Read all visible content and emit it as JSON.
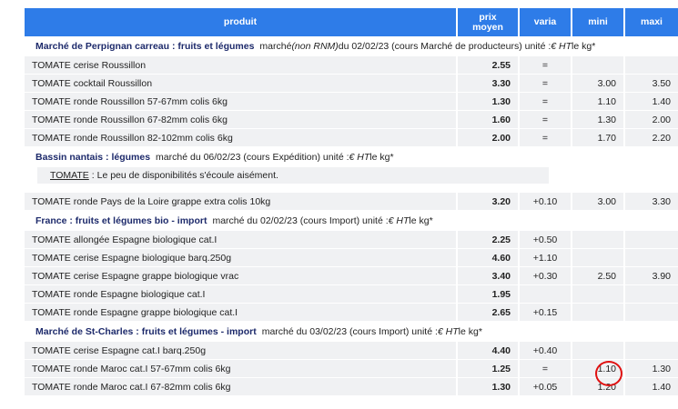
{
  "header": {
    "produit": "produit",
    "prix": "prix",
    "moyen": "moyen",
    "varia": "varia",
    "mini": "mini",
    "maxi": "maxi"
  },
  "sections": [
    {
      "title": "Marché de Perpignan carreau : fruits et légumes",
      "info_pre": "marché ",
      "info_italic": "(non RNM)",
      "info_mid": " du 02/02/23 (cours Marché de producteurs) unité : ",
      "info_unit": "€ HT",
      "info_post": " le kg*",
      "rows": [
        {
          "produit": "TOMATE cerise Roussillon",
          "prix": "2.55",
          "varia": "=",
          "mini": "",
          "maxi": ""
        },
        {
          "produit": "TOMATE cocktail Roussillon",
          "prix": "3.30",
          "varia": "=",
          "mini": "3.00",
          "maxi": "3.50"
        },
        {
          "produit": "TOMATE ronde Roussillon 57-67mm colis 6kg",
          "prix": "1.30",
          "varia": "=",
          "mini": "1.10",
          "maxi": "1.40"
        },
        {
          "produit": "TOMATE ronde Roussillon 67-82mm colis 6kg",
          "prix": "1.60",
          "varia": "=",
          "mini": "1.30",
          "maxi": "2.00"
        },
        {
          "produit": "TOMATE ronde Roussillon 82-102mm colis 6kg",
          "prix": "2.00",
          "varia": "=",
          "mini": "1.70",
          "maxi": "2.20"
        }
      ]
    },
    {
      "title": "Bassin nantais : légumes",
      "info_pre": "marché du 06/02/23 (cours Expédition) unité : ",
      "info_unit": "€ HT",
      "info_post": " le kg*",
      "note_label": "TOMATE",
      "note_text": ": Le peu de disponibilités s'écoule aisément.",
      "rows": [
        {
          "produit": "TOMATE ronde Pays de la Loire grappe extra colis 10kg",
          "prix": "3.20",
          "varia": "+0.10",
          "mini": "3.00",
          "maxi": "3.30"
        }
      ]
    },
    {
      "title": "France : fruits et légumes bio - import",
      "info_pre": "marché du 02/02/23 (cours Import) unité : ",
      "info_unit": "€ HT",
      "info_post": " le kg*",
      "rows": [
        {
          "produit": "TOMATE allongée Espagne biologique cat.I",
          "prix": "2.25",
          "varia": "+0.50",
          "mini": "",
          "maxi": ""
        },
        {
          "produit": "TOMATE cerise Espagne biologique barq.250g",
          "prix": "4.60",
          "varia": "+1.10",
          "mini": "",
          "maxi": ""
        },
        {
          "produit": "TOMATE cerise Espagne grappe biologique vrac",
          "prix": "3.40",
          "varia": "+0.30",
          "mini": "2.50",
          "maxi": "3.90"
        },
        {
          "produit": "TOMATE ronde Espagne biologique cat.I",
          "prix": "1.95",
          "varia": "",
          "mini": "",
          "maxi": ""
        },
        {
          "produit": "TOMATE ronde Espagne grappe biologique cat.I",
          "prix": "2.65",
          "varia": "+0.15",
          "mini": "",
          "maxi": ""
        }
      ]
    },
    {
      "title": "Marché de St-Charles : fruits et légumes - import",
      "info_pre": "marché du 03/02/23 (cours Import) unité : ",
      "info_unit": "€ HT",
      "info_post": " le kg*",
      "rows": [
        {
          "produit": "TOMATE cerise Espagne cat.I barq.250g",
          "prix": "4.40",
          "varia": "+0.40",
          "mini": "",
          "maxi": ""
        },
        {
          "produit": "TOMATE ronde Maroc cat.I 57-67mm colis 6kg",
          "prix": "1.25",
          "varia": "=",
          "mini": "1.10",
          "maxi": "1.30"
        },
        {
          "produit": "TOMATE ronde Maroc cat.I 67-82mm colis 6kg",
          "prix": "1.30",
          "varia": "+0.05",
          "mini": "1.20",
          "maxi": "1.40"
        }
      ]
    }
  ],
  "highlight_color": "#e01010",
  "header_color": "#2e7ce8"
}
